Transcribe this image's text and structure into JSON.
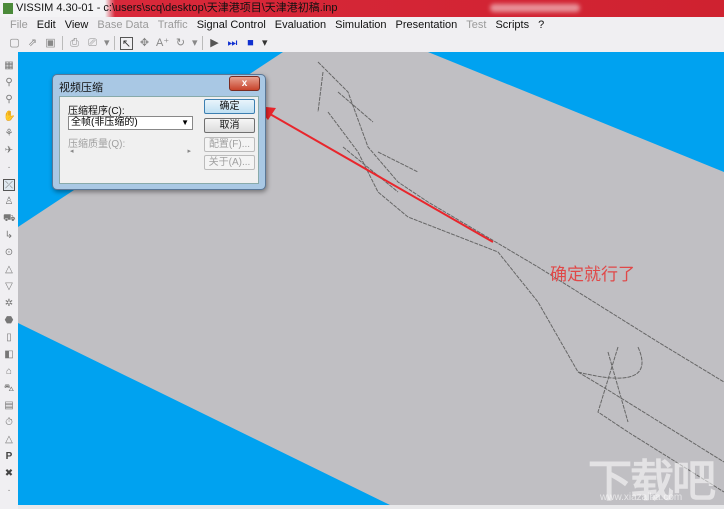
{
  "window": {
    "title": "VISSIM 4.30-01 - c:\\users\\scq\\desktop\\天津港项目\\天津港初稿.inp"
  },
  "menu": [
    {
      "label": "File",
      "enabled": false
    },
    {
      "label": "Edit",
      "enabled": true
    },
    {
      "label": "View",
      "enabled": true
    },
    {
      "label": "Base Data",
      "enabled": false
    },
    {
      "label": "Traffic",
      "enabled": false
    },
    {
      "label": "Signal Control",
      "enabled": true
    },
    {
      "label": "Evaluation",
      "enabled": true
    },
    {
      "label": "Simulation",
      "enabled": true
    },
    {
      "label": "Presentation",
      "enabled": true
    },
    {
      "label": "Test",
      "enabled": false
    },
    {
      "label": "Scripts",
      "enabled": true
    },
    {
      "label": "?",
      "enabled": true
    }
  ],
  "dialog": {
    "title": "视频压缩",
    "close_label": "x",
    "compressor_label": "压缩程序(C):",
    "compressor_value": "全帧(非压缩的)",
    "quality_label": "压缩质量(Q):",
    "ok_label": "确定",
    "cancel_label": "取消",
    "configure_label": "配置(F)...",
    "about_label": "关于(A)..."
  },
  "annotation": {
    "text": "确定就行了",
    "color": "#e04848"
  },
  "watermark": {
    "text": "下载吧",
    "url": "www.xiazaiba.com"
  },
  "colors": {
    "background": "#00a2f0",
    "network": "#c0bfc3",
    "arrow": "#e8262c"
  }
}
